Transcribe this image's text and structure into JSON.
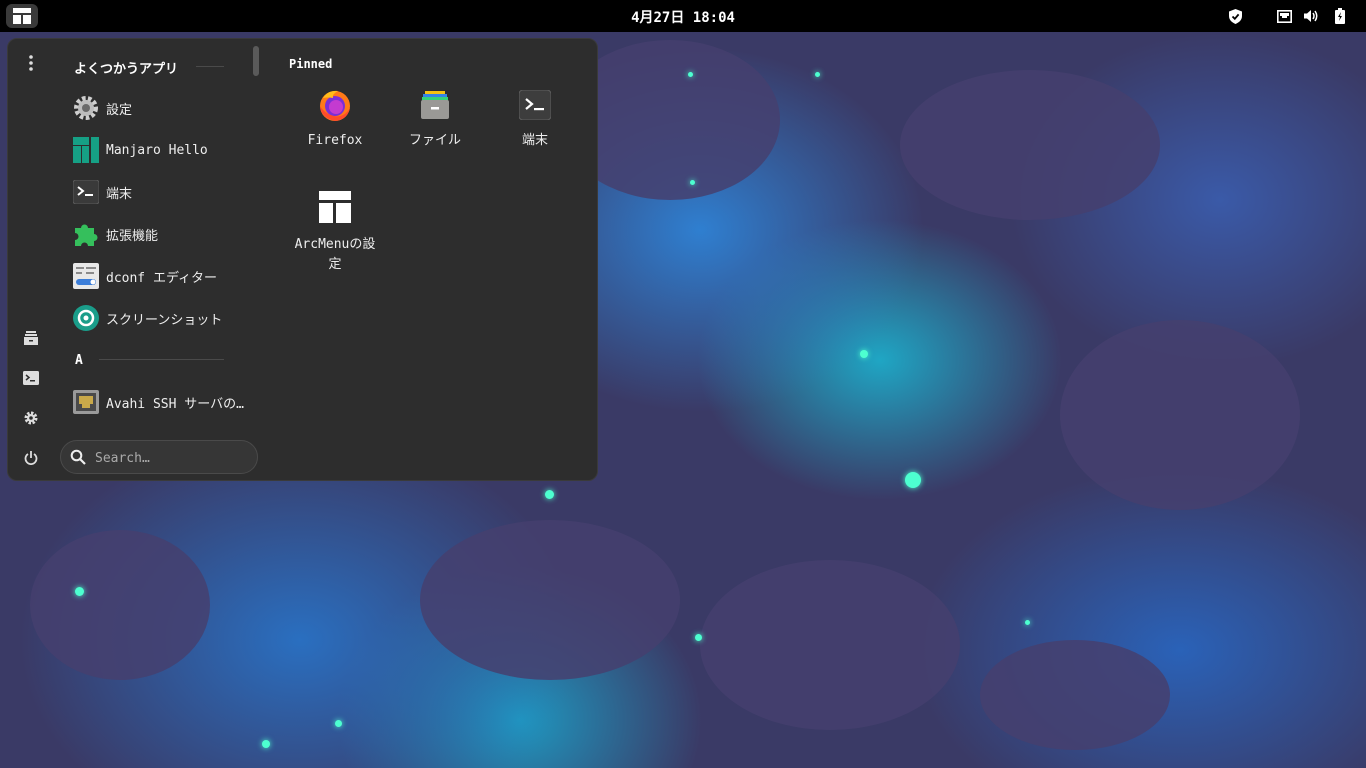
{
  "topbar": {
    "clock": "4月27日  18:04",
    "tray_icons": [
      "shield-icon",
      "network-wired-icon",
      "volume-icon",
      "battery-icon"
    ]
  },
  "menu": {
    "frequent_title": "よくつかうアプリ",
    "frequent_apps": [
      {
        "label": "設定",
        "icon": "settings-gear-icon"
      },
      {
        "label": "Manjaro Hello",
        "icon": "manjaro-logo-icon"
      },
      {
        "label": "端末",
        "icon": "terminal-icon"
      },
      {
        "label": "拡張機能",
        "icon": "extensions-puzzle-icon"
      },
      {
        "label": "dconf エディター",
        "icon": "dconf-editor-icon"
      },
      {
        "label": "スクリーンショット",
        "icon": "screenshot-icon"
      }
    ],
    "letter_section": "A",
    "a_apps": [
      {
        "label": "Avahi SSH サーバの…",
        "icon": "network-server-icon"
      }
    ],
    "pinned_title": "Pinned",
    "pinned": [
      {
        "label": "Firefox",
        "icon": "firefox-icon"
      },
      {
        "label": "ファイル",
        "icon": "files-icon"
      },
      {
        "label": "端末",
        "icon": "terminal-icon"
      },
      {
        "label": "ArcMenuの設定",
        "icon": "arcmenu-settings-icon"
      }
    ],
    "sidebar": [
      "options-menu-icon",
      "files-icon",
      "terminal-icon",
      "settings-icon",
      "power-icon"
    ],
    "search_placeholder": "Search…"
  },
  "colors": {
    "panel_bg": "#2d2d2d",
    "topbar_bg": "#000000",
    "accent_green": "#35bf5c",
    "manjaro_teal": "#16a085"
  }
}
